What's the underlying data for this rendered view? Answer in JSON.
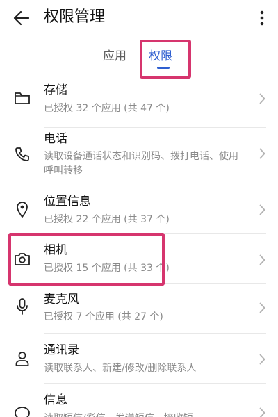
{
  "header": {
    "title": "权限管理",
    "back_icon": "arrow-left-icon",
    "more_icon": "more-vertical-icon"
  },
  "tabs": [
    {
      "label": "应用",
      "selected": false
    },
    {
      "label": "权限",
      "selected": true
    }
  ],
  "accent_color": "#2f5fd0",
  "highlight_color": "#d6356e",
  "permissions": [
    {
      "icon": "folder-icon",
      "title": "存储",
      "subtitle": "已授权 32 个应用 (共 47 个)"
    },
    {
      "icon": "phone-icon",
      "title": "电话",
      "subtitle": "读取设备通话状态和识别码、拨打电话、使用呼叫转移"
    },
    {
      "icon": "location-pin-icon",
      "title": "位置信息",
      "subtitle": "已授权 22 个应用 (共 37 个)"
    },
    {
      "icon": "camera-icon",
      "title": "相机",
      "subtitle": "已授权 15 个应用 (共 33 个)"
    },
    {
      "icon": "microphone-icon",
      "title": "麦克风",
      "subtitle": "已授权 7 个应用 (共 27 个)"
    },
    {
      "icon": "contacts-icon",
      "title": "通讯录",
      "subtitle": "读取联系人、新建/修改/删除联系人"
    },
    {
      "icon": "message-icon",
      "title": "信息",
      "subtitle": "读取短信/彩信、发送短信、接收短"
    }
  ]
}
